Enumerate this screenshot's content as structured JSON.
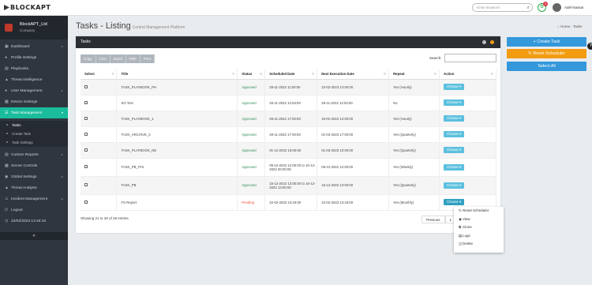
{
  "app": {
    "logo": "BLOCKAPT"
  },
  "header": {
    "search_placeholder": "Enter keyword",
    "search_icon": "search-icon",
    "notifications": "0",
    "user_name": "Adel Nassar"
  },
  "sidebar": {
    "company_name": "BlockAPT_Ltd",
    "company_sub": "Company",
    "items": [
      {
        "label": "Dashboard",
        "icon": "monitor-icon"
      },
      {
        "label": "Profile Settings",
        "icon": "user-icon"
      },
      {
        "label": "Playbooks",
        "icon": "book-icon"
      },
      {
        "label": "Threat Intelligence",
        "icon": "shield-icon"
      },
      {
        "label": "User Management",
        "icon": "users-icon"
      },
      {
        "label": "Device Settings",
        "icon": "device-icon"
      },
      {
        "label": "Task Management",
        "icon": "tasks-icon"
      }
    ],
    "sub_items": [
      "Tasks",
      "Create Task",
      "Task Settings"
    ],
    "items2": [
      {
        "label": "Custom Reports",
        "icon": "report-icon"
      },
      {
        "label": "Server Controls",
        "icon": "server-icon"
      },
      {
        "label": "Global Settings",
        "icon": "globe-icon"
      },
      {
        "label": "Threat Analysis",
        "icon": "analysis-icon"
      },
      {
        "label": "Incident Management",
        "icon": "incident-icon"
      },
      {
        "label": "Logout",
        "icon": "power-icon"
      },
      {
        "label": "22/02/2023 13:19:15",
        "icon": "clock-icon"
      }
    ]
  },
  "page": {
    "title": "Tasks - Listing",
    "subtitle": "Central Management Platform",
    "breadcrumb_home": "Home",
    "breadcrumb_current": "Tasks"
  },
  "panel": {
    "title": "Tasks",
    "exports": [
      "Copy",
      "CSV",
      "Excel",
      "PDF",
      "Print"
    ],
    "search_label": "Search:",
    "columns": [
      "Select",
      "Title",
      "Status",
      "Scheduled Date",
      "Next Execution Date",
      "Repeat",
      "Action"
    ],
    "rows": [
      {
        "title": "TASK_PLAYBOOK_PH",
        "status": "Approved",
        "sched": "29-11-2022 11:00:00",
        "next": "22-02-2023 14:00:00",
        "repeat": "Yes (Hourly)"
      },
      {
        "title": "SO Test",
        "status": "Approved",
        "sched": "29-11-2022 12:53:00",
        "next": "29-11-2022 12:53:00",
        "repeat": "No"
      },
      {
        "title": "TASK_PLAYBOOK_1",
        "status": "Approved",
        "sched": "29-11-2022 17:00:00",
        "next": "19-02-2023 12:00:00",
        "repeat": "Yes (Hourly)"
      },
      {
        "title": "TASK_ARCHIVE_2",
        "status": "Approved",
        "sched": "29-11-2022 17:00:00",
        "next": "01-03-2023 17:00:00",
        "repeat": "Yes (Quarterly)"
      },
      {
        "title": "TASK_PLAYBOOK_NE",
        "status": "Approved",
        "sched": "01-12-2022 15:00:00",
        "next": "01-03-2023 10:00:00",
        "repeat": "Yes (Quarterly)"
      },
      {
        "title": "TASK_PB_PHI",
        "status": "Approved",
        "sched": "09-12-2022 12:00:00 to 10-12-2022 00:00:00",
        "next": "09-12-2022 12:00:00",
        "repeat": "Yes (Weekly)"
      },
      {
        "title": "TASK_PB",
        "status": "Approved",
        "sched": "15-12-2022 13:00:00 to 16-12-2022 13:00:00",
        "next": "15-12-2022 13:00:00",
        "repeat": "Yes (Quarterly)"
      },
      {
        "title": "FS Report",
        "status": "Pending",
        "sched": "22-02-2023 13:19:00",
        "next": "22-02-2023 13:19:00",
        "repeat": "Yes (Monthly)"
      }
    ],
    "choose_label": "Choose",
    "showing": "Showing 21 to 28 of 28 entries",
    "pager_prev": "Previous",
    "pager_page": "1"
  },
  "dropdown": [
    "Reset Scheduler",
    "View",
    "Clone",
    "Logs",
    "Delete"
  ],
  "right_buttons": {
    "create": "+ Create Task",
    "reset": "Reset Scheduler",
    "select_all": "Select All"
  },
  "help": "?"
}
